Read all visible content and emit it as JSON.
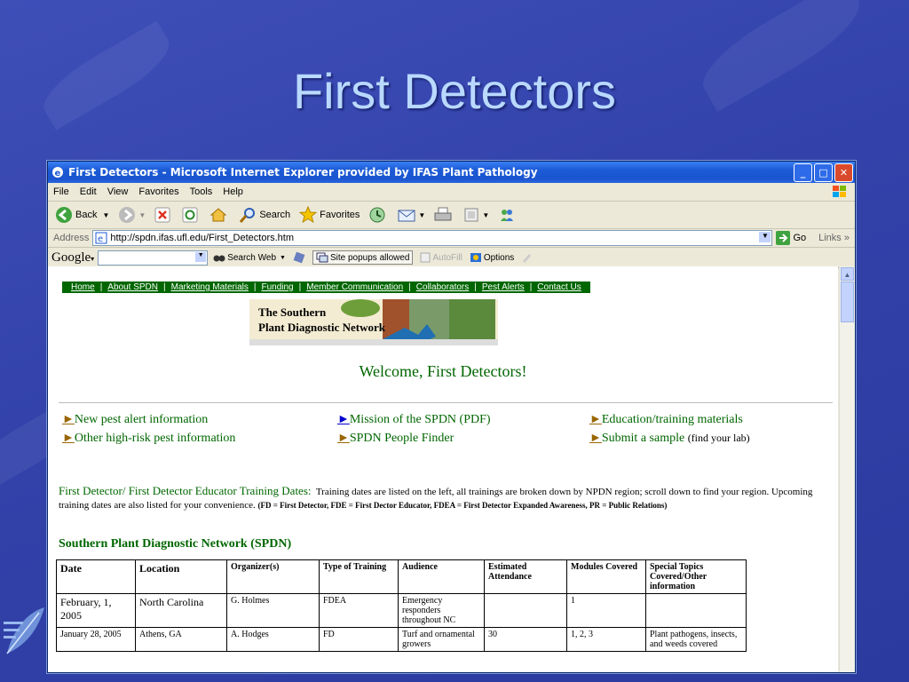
{
  "slide": {
    "title": "First Detectors"
  },
  "window": {
    "title": "First Detectors - Microsoft Internet Explorer provided by IFAS Plant Pathology",
    "controls": {
      "minimize": "_",
      "maximize": "□",
      "close": "✕"
    }
  },
  "menu": [
    "File",
    "Edit",
    "View",
    "Favorites",
    "Tools",
    "Help"
  ],
  "toolbar": {
    "back": "Back",
    "search": "Search",
    "favorites": "Favorites"
  },
  "address": {
    "label": "Address",
    "url": "http://spdn.ifas.ufl.edu/First_Detectors.htm",
    "go": "Go",
    "links": "Links"
  },
  "google": {
    "logo": "Google",
    "search_web": "Search Web",
    "popups": "Site popups allowed",
    "autofill": "AutoFill",
    "options": "Options"
  },
  "page": {
    "nav": [
      "Home",
      "About SPDN",
      "Marketing Materials",
      "Funding",
      "Member Communication",
      "Collaborators",
      "Pest Alerts",
      "Contact Us"
    ],
    "banner_line1": "The Southern",
    "banner_line2": "Plant Diagnostic Network",
    "welcome": "Welcome, First Detectors!",
    "links": {
      "new_pest": "New pest alert information",
      "other_pest": "Other high-risk pest information",
      "mission": "Mission of the SPDN (PDF)",
      "people_finder": "SPDN People Finder",
      "education": "Education/training materials",
      "submit": "Submit a sample",
      "submit_note": "(find your lab)",
      "arrow": "►"
    },
    "training_heading": "First Detector/ First Detector Educator Training Dates:",
    "training_text": "Training dates are listed on the left, all trainings are broken down by NPDN region; scroll down to find your region.  Upcoming training dates are also listed for your convenience.",
    "training_note": "(FD = First Detector, FDE = First Dector Educator, FDEA = First Detector Expanded Awareness, PR = Public Relations)",
    "region_title": "Southern Plant Diagnostic Network (SPDN)",
    "table": {
      "headers": [
        "Date",
        "Location",
        "Organizer(s)",
        "Type of Training",
        "Audience",
        "Estimated Attendance",
        "Modules Covered",
        "Special Topics Covered/Other information"
      ],
      "rows": [
        [
          "February, 1, 2005",
          "North Carolina",
          "G. Holmes",
          "FDEA",
          "Emergency responders throughout NC",
          "",
          "1",
          ""
        ],
        [
          "January 28, 2005",
          "Athens, GA",
          "A. Hodges",
          "FD",
          "Turf and ornamental growers",
          "30",
          "1, 2, 3",
          "Plant pathogens, insects, and weeds covered"
        ]
      ]
    }
  },
  "colors": {
    "slide_bg": "#3446ad",
    "title": "#b9d9ff",
    "nav_bg": "#006600",
    "page_green": "#006600",
    "xp_blue": "#1c5ad6"
  }
}
